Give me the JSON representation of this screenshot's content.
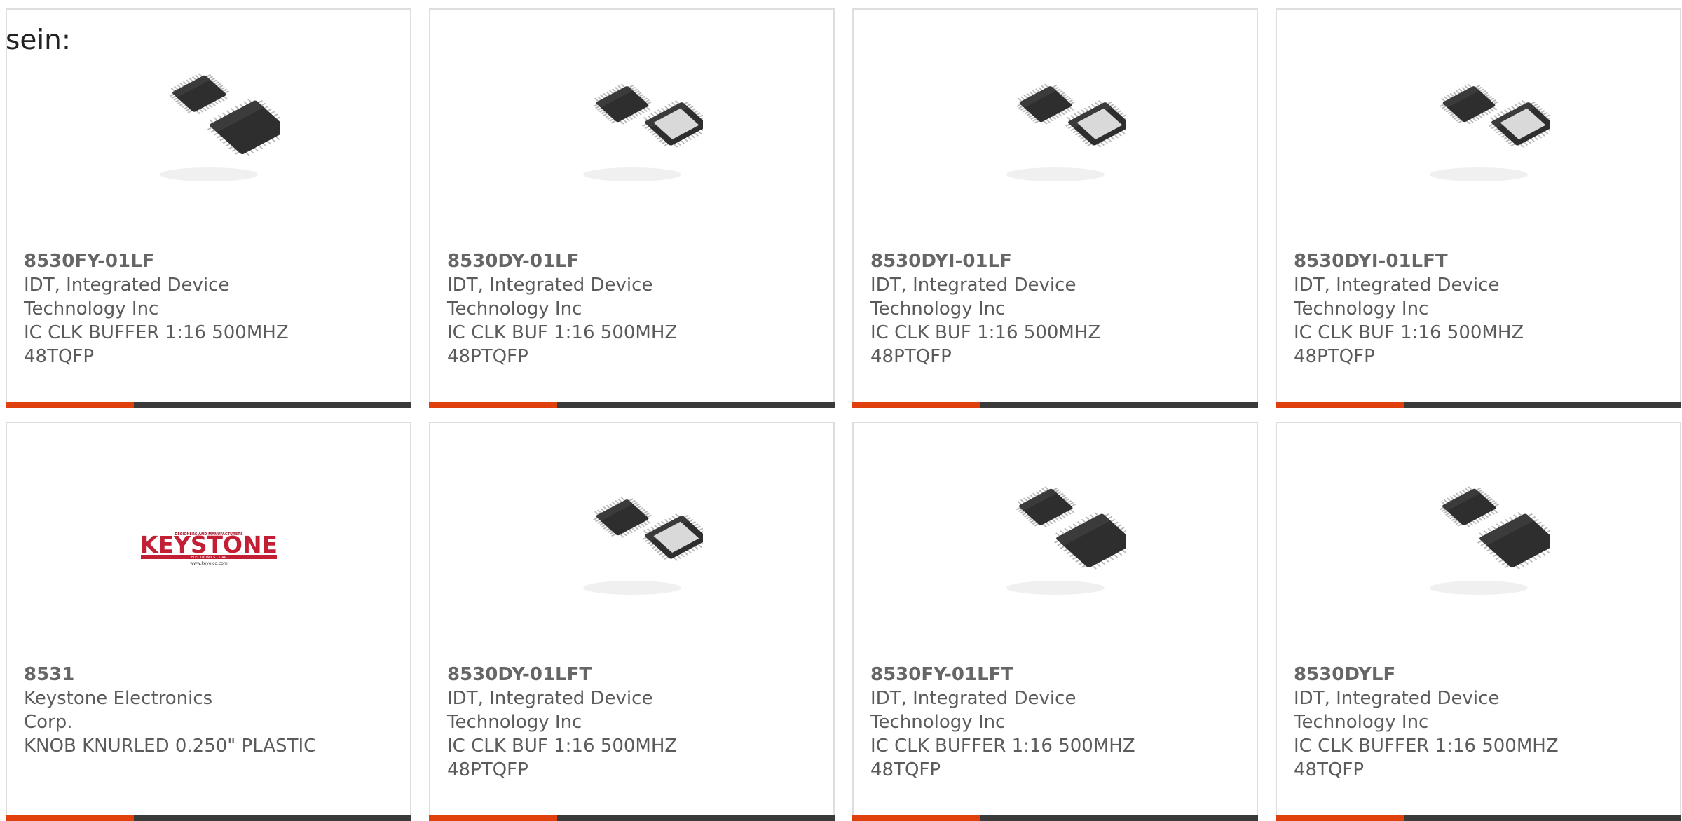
{
  "intro_text": "sein:",
  "accent_color": "#e0400b",
  "bar_color": "#3a3a3a",
  "products": [
    {
      "part": "8530FY-01LF",
      "manufacturer": "IDT, Integrated Device Technology Inc",
      "description": "IC CLK BUFFER 1:16 500MHZ 48TQFP",
      "image": "chip-pair-dark-image"
    },
    {
      "part": "8530DY-01LF",
      "manufacturer": "IDT, Integrated Device Technology Inc",
      "description": "IC CLK BUF 1:16 500MHZ 48PTQFP",
      "image": "chip-pair-pad-image"
    },
    {
      "part": "8530DYI-01LF",
      "manufacturer": "IDT, Integrated Device Technology Inc",
      "description": "IC CLK BUF 1:16 500MHZ 48PTQFP",
      "image": "chip-pair-pad-image"
    },
    {
      "part": "8530DYI-01LFT",
      "manufacturer": "IDT, Integrated Device Technology Inc",
      "description": "IC CLK BUF 1:16 500MHZ 48PTQFP",
      "image": "chip-pair-pad-image"
    },
    {
      "part": "8531",
      "manufacturer": "Keystone Electronics Corp.",
      "description": "KNOB KNURLED 0.250\" PLASTIC",
      "image": "keystone-logo-image",
      "logo": {
        "top_text": "DESIGNERS AND MANUFACTURERS",
        "brand": "KEYSTONE",
        "sub_text": "ELECTRONICS CORP.",
        "url": "www.keyelco.com"
      }
    },
    {
      "part": "8530DY-01LFT",
      "manufacturer": "IDT, Integrated Device Technology Inc",
      "description": "IC CLK BUF 1:16 500MHZ 48PTQFP",
      "image": "chip-pair-pad-image"
    },
    {
      "part": "8530FY-01LFT",
      "manufacturer": "IDT, Integrated Device Technology Inc",
      "description": "IC CLK BUFFER 1:16 500MHZ 48TQFP",
      "image": "chip-pair-dark-image"
    },
    {
      "part": "8530DYLF",
      "manufacturer": "IDT, Integrated Device Technology Inc",
      "description": "IC CLK BUFFER 1:16 500MHZ 48TQFP",
      "image": "chip-pair-dark-image"
    }
  ]
}
